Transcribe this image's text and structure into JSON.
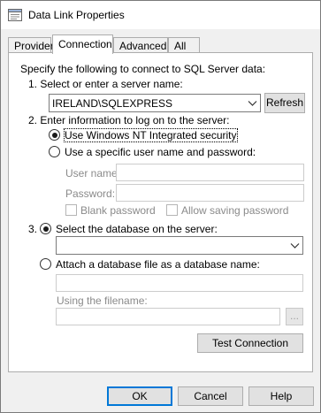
{
  "window": {
    "title": "Data Link Properties",
    "icon": "data-link-icon"
  },
  "tabs": [
    {
      "label": "Provider",
      "active": false
    },
    {
      "label": "Connection",
      "active": true
    },
    {
      "label": "Advanced",
      "active": false
    },
    {
      "label": "All",
      "active": false
    }
  ],
  "connection": {
    "intro": "Specify the following to connect to SQL Server data:",
    "step1_label": "1. Select or enter a server name:",
    "server_name": "IRELAND\\SQLEXPRESS",
    "refresh_label": "Refresh",
    "step2_label": "2. Enter information to log on to the server:",
    "auth_windows_label": "Use Windows NT Integrated security",
    "auth_windows_checked": true,
    "auth_specific_label": "Use a specific user name and password:",
    "auth_specific_checked": false,
    "username_label": "User name:",
    "username_value": "",
    "password_label": "Password:",
    "password_value": "",
    "blank_password_label": "Blank password",
    "allow_saving_label": "Allow saving password",
    "step3_label": "3.",
    "select_db_label": "Select the database on the server:",
    "select_db_checked": true,
    "database_value": "",
    "attach_db_label": "Attach a database file as a database name:",
    "attach_db_checked": false,
    "attach_name_value": "",
    "using_filename_label": "Using the filename:",
    "filename_value": "",
    "browse_label": "...",
    "test_connection_label": "Test Connection"
  },
  "footer": {
    "ok_label": "OK",
    "cancel_label": "Cancel",
    "help_label": "Help"
  }
}
